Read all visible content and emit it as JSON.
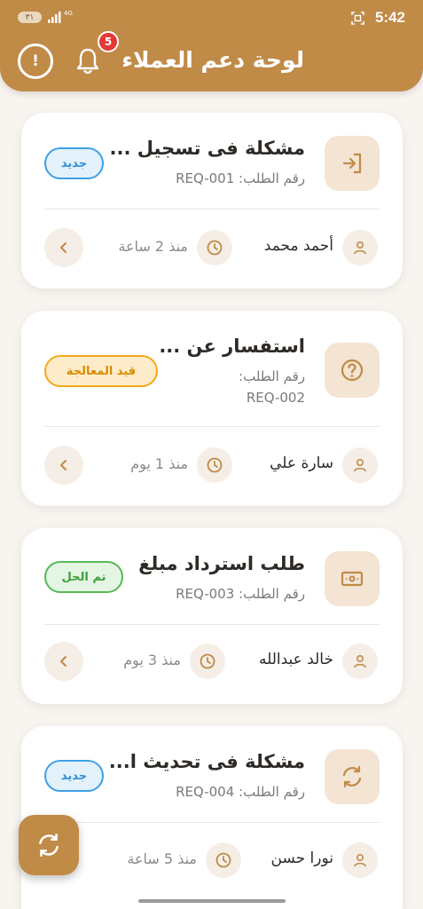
{
  "status_bar": {
    "time": "5:42",
    "battery": "٣١",
    "network": "4G"
  },
  "header": {
    "title": "لوحة دعم العملاء",
    "notifications_count": "5",
    "info_glyph": "!",
    "background_color": "#c08a47"
  },
  "tickets": [
    {
      "icon": "login-icon",
      "title": "مشكلة فى تسجيل ...",
      "request_number": "رقم الطلب: REQ-001",
      "status": "جديد",
      "status_type": "new",
      "customer": "أحمد محمد",
      "time_ago": "منذ 2 ساعة"
    },
    {
      "icon": "help-icon",
      "title": "استفسار عن ...",
      "request_number_line1": "رقم الطلب:",
      "request_number_line2": "REQ-002",
      "status": "قيد المعالجة",
      "status_type": "in-progress",
      "customer": "سارة علي",
      "time_ago": "منذ 1 يوم"
    },
    {
      "icon": "money-icon",
      "title": "طلب استرداد مبلغ",
      "request_number": "رقم الطلب: REQ-003",
      "status": "تم الحل",
      "status_type": "resolved",
      "customer": "خالد عبدالله",
      "time_ago": "منذ 3 يوم"
    },
    {
      "icon": "sync-icon",
      "title": "مشكلة فى تحديث ا...",
      "request_number": "رقم الطلب: REQ-004",
      "status": "جديد",
      "status_type": "new",
      "customer": "نورا حسن",
      "time_ago": "منذ 5 ساعة"
    }
  ],
  "colors": {
    "accent": "#c08a47",
    "new": "#3ea0e6",
    "in_progress": "#f3a81a",
    "resolved": "#55b955"
  }
}
